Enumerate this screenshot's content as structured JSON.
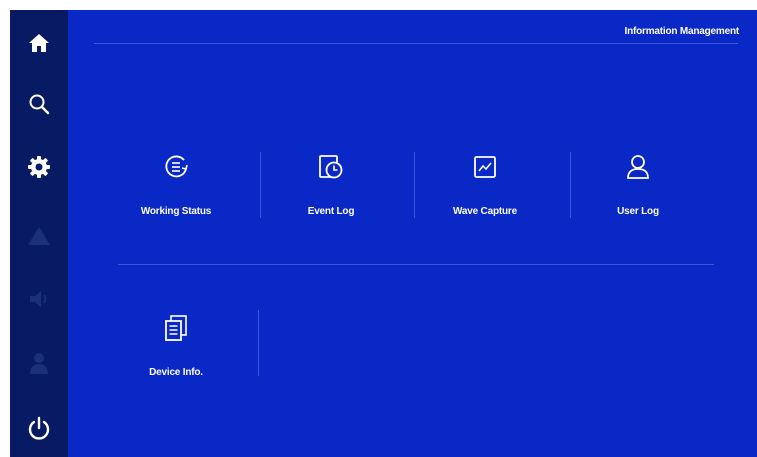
{
  "header": {
    "title": "Information Management"
  },
  "sidebar": {
    "items": [
      {
        "icon": "home-icon"
      },
      {
        "icon": "search-icon"
      },
      {
        "icon": "gear-icon"
      },
      {
        "icon": "warning-icon"
      },
      {
        "icon": "speaker-icon"
      },
      {
        "icon": "user-icon"
      },
      {
        "icon": "power-icon"
      }
    ]
  },
  "tiles": [
    {
      "label": "Working Status",
      "icon": "working-status-icon"
    },
    {
      "label": "Event Log",
      "icon": "event-log-icon"
    },
    {
      "label": "Wave Capture",
      "icon": "wave-capture-icon"
    },
    {
      "label": "User Log",
      "icon": "user-log-icon"
    },
    {
      "label": "Device Info.",
      "icon": "device-info-icon"
    }
  ],
  "colors": {
    "sidebar": "#071a63",
    "main": "#0a28c6",
    "active_icon": "#ffffff",
    "inactive_icon": "#1b2f7a"
  }
}
